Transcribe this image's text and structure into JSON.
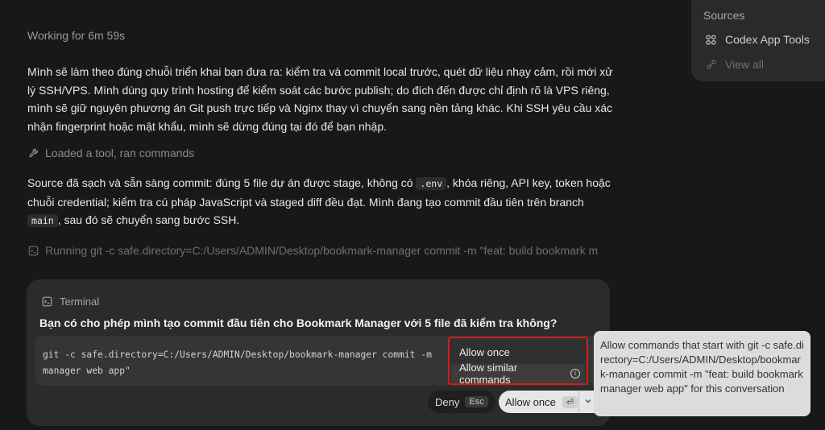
{
  "status": {
    "text": "Working for 6m 59s"
  },
  "messages": {
    "para1": "Mình sẽ làm theo đúng chuỗi triển khai bạn đưa ra: kiểm tra và commit local trước, quét dữ liệu nhạy cảm, rồi mới xử lý SSH/VPS. Mình dùng quy trình hosting để kiểm soát các bước publish; do đích đến được chỉ định rõ là VPS riêng, mình sẽ giữ nguyên phương án Git push trực tiếp và Nginx thay vì chuyển sang nền tảng khác. Khi SSH yêu cầu xác nhận fingerprint hoặc mật khẩu, mình sẽ dừng đúng tại đó để bạn nhập.",
    "tool_loaded": "Loaded a tool, ran commands",
    "para2_a": "Source đã sạch và sẵn sàng commit: đúng 5 file dự án được stage, không có ",
    "para2_code1": ".env",
    "para2_b": ", khóa riêng, API key, token hoặc chuỗi credential; kiểm tra cú pháp JavaScript và staged diff đều đạt. Mình đang tạo commit đầu tiên trên branch ",
    "para2_code2": "main",
    "para2_c": ", sau đó sẽ chuyển sang bước SSH.",
    "running": "Running git -c safe.directory=C:/Users/ADMIN/Desktop/bookmark-manager commit -m \"feat: build bookmark m"
  },
  "sources": {
    "title": "Sources",
    "items": [
      {
        "label": "Codex App Tools",
        "icon": "apps-grid-icon"
      },
      {
        "label": "View all",
        "icon": "link-icon"
      }
    ]
  },
  "terminal": {
    "header": "Terminal",
    "question": "Bạn có cho phép mình tạo commit đầu tiên cho Bookmark Manager với 5 file đã kiểm tra không?",
    "command": "git -c safe.directory=C:/Users/ADMIN/Desktop/bookmark-manager commit -m \nmanager web app\"",
    "deny_label": "Deny",
    "deny_key": "Esc",
    "allow_label": "Allow once",
    "allow_key": "⏎"
  },
  "menu": {
    "once": "Allow once",
    "similar": "Allow similar commands"
  },
  "tooltip": {
    "text": "Allow commands that start with git -c safe.directory=C:/Users/ADMIN/Desktop/bookmark-manager commit -m \"feat: build bookmark manager web app\" for this conversation"
  },
  "colors": {
    "background": "#181818",
    "highlight_border": "#d41c1c",
    "tooltip_bg": "#dcdcdc"
  }
}
